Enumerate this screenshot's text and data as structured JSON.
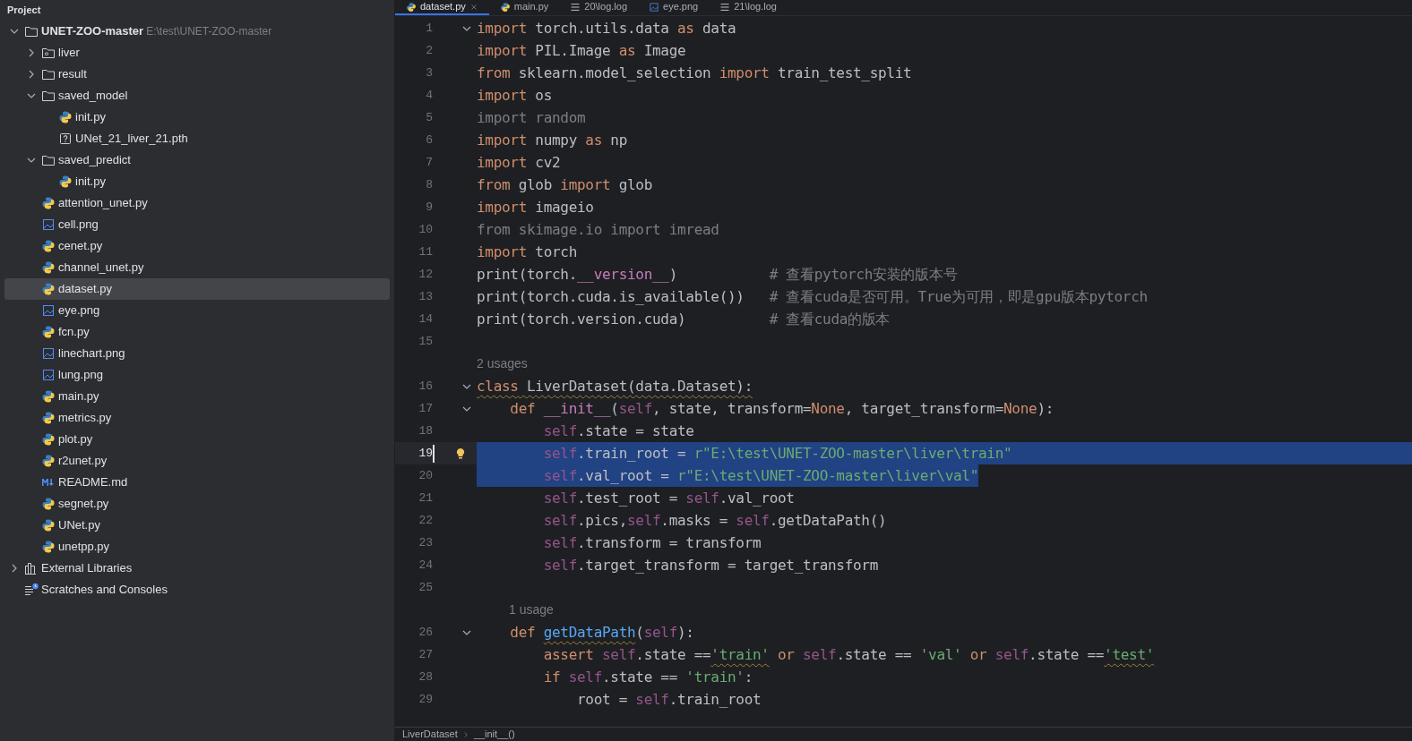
{
  "sidebar": {
    "title": "Project",
    "tree": [
      {
        "label": "UNET-ZOO-master",
        "path": "E:\\test\\UNET-ZOO-master",
        "kind": "folder",
        "expanded": true,
        "selected": false,
        "children": [
          {
            "label": "liver",
            "kind": "module-folder",
            "expanded": false,
            "selected": false
          },
          {
            "label": "result",
            "kind": "folder",
            "expanded": false,
            "selected": false
          },
          {
            "label": "saved_model",
            "kind": "folder",
            "expanded": true,
            "selected": false,
            "children": [
              {
                "label": "init.py",
                "kind": "python",
                "selected": false
              },
              {
                "label": "UNet_21_liver_21.pth",
                "kind": "unknown",
                "selected": false
              }
            ]
          },
          {
            "label": "saved_predict",
            "kind": "folder",
            "expanded": true,
            "selected": false,
            "children": [
              {
                "label": "init.py",
                "kind": "python",
                "selected": false
              }
            ]
          },
          {
            "label": "attention_unet.py",
            "kind": "python",
            "selected": false
          },
          {
            "label": "cell.png",
            "kind": "image",
            "selected": false
          },
          {
            "label": "cenet.py",
            "kind": "python",
            "selected": false
          },
          {
            "label": "channel_unet.py",
            "kind": "python",
            "selected": false
          },
          {
            "label": "dataset.py",
            "kind": "python",
            "selected": true
          },
          {
            "label": "eye.png",
            "kind": "image",
            "selected": false
          },
          {
            "label": "fcn.py",
            "kind": "python",
            "selected": false
          },
          {
            "label": "linechart.png",
            "kind": "image",
            "selected": false
          },
          {
            "label": "lung.png",
            "kind": "image",
            "selected": false
          },
          {
            "label": "main.py",
            "kind": "python",
            "selected": false
          },
          {
            "label": "metrics.py",
            "kind": "python",
            "selected": false
          },
          {
            "label": "plot.py",
            "kind": "python",
            "selected": false
          },
          {
            "label": "r2unet.py",
            "kind": "python",
            "selected": false
          },
          {
            "label": "README.md",
            "kind": "markdown",
            "selected": false
          },
          {
            "label": "segnet.py",
            "kind": "python",
            "selected": false
          },
          {
            "label": "UNet.py",
            "kind": "python",
            "selected": false
          },
          {
            "label": "unetpp.py",
            "kind": "python",
            "selected": false
          }
        ]
      },
      {
        "label": "External Libraries",
        "kind": "libraries",
        "expanded": false,
        "selected": false
      },
      {
        "label": "Scratches and Consoles",
        "kind": "scratches",
        "selected": false
      }
    ]
  },
  "tabs": [
    {
      "label": "dataset.py",
      "kind": "python",
      "selected": true,
      "closable": true
    },
    {
      "label": "main.py",
      "kind": "python",
      "selected": false,
      "closable": false
    },
    {
      "label": "20\\log.log",
      "kind": "text",
      "selected": false,
      "closable": false
    },
    {
      "label": "eye.png",
      "kind": "image",
      "selected": false,
      "closable": false
    },
    {
      "label": "21\\log.log",
      "kind": "text",
      "selected": false,
      "closable": false
    }
  ],
  "editor": {
    "lines": [
      {
        "kind": "code",
        "number": "1",
        "fold": true,
        "selected": false,
        "current": false,
        "tokens": [
          {
            "kind": "keyword",
            "text": "import"
          },
          {
            "kind": "plain",
            "text": " torch.utils.data "
          },
          {
            "kind": "keyword",
            "text": "as"
          },
          {
            "kind": "plain",
            "text": " data"
          }
        ]
      },
      {
        "kind": "code",
        "number": "2",
        "fold": false,
        "selected": false,
        "current": false,
        "tokens": [
          {
            "kind": "keyword",
            "text": "import"
          },
          {
            "kind": "plain",
            "text": " PIL.Image "
          },
          {
            "kind": "keyword",
            "text": "as"
          },
          {
            "kind": "plain",
            "text": " Image"
          }
        ]
      },
      {
        "kind": "code",
        "number": "3",
        "fold": false,
        "selected": false,
        "current": false,
        "tokens": [
          {
            "kind": "keyword",
            "text": "from"
          },
          {
            "kind": "plain",
            "text": " sklearn.model_selection "
          },
          {
            "kind": "keyword",
            "text": "import"
          },
          {
            "kind": "plain",
            "text": " train_test_split"
          }
        ]
      },
      {
        "kind": "code",
        "number": "4",
        "fold": false,
        "selected": false,
        "current": false,
        "tokens": [
          {
            "kind": "keyword",
            "text": "import"
          },
          {
            "kind": "plain",
            "text": " os"
          }
        ]
      },
      {
        "kind": "code",
        "number": "5",
        "fold": false,
        "selected": false,
        "current": false,
        "tokens": [
          {
            "kind": "unused",
            "text": "import random"
          }
        ]
      },
      {
        "kind": "code",
        "number": "6",
        "fold": false,
        "selected": false,
        "current": false,
        "tokens": [
          {
            "kind": "keyword",
            "text": "import"
          },
          {
            "kind": "plain",
            "text": " numpy "
          },
          {
            "kind": "keyword",
            "text": "as"
          },
          {
            "kind": "plain",
            "text": " np"
          }
        ]
      },
      {
        "kind": "code",
        "number": "7",
        "fold": false,
        "selected": false,
        "current": false,
        "tokens": [
          {
            "kind": "keyword",
            "text": "import"
          },
          {
            "kind": "plain",
            "text": " cv2"
          }
        ]
      },
      {
        "kind": "code",
        "number": "8",
        "fold": false,
        "selected": false,
        "current": false,
        "tokens": [
          {
            "kind": "keyword",
            "text": "from"
          },
          {
            "kind": "plain",
            "text": " glob "
          },
          {
            "kind": "keyword",
            "text": "import"
          },
          {
            "kind": "plain",
            "text": " glob"
          }
        ]
      },
      {
        "kind": "code",
        "number": "9",
        "fold": false,
        "selected": false,
        "current": false,
        "tokens": [
          {
            "kind": "keyword",
            "text": "import"
          },
          {
            "kind": "plain",
            "text": " imageio"
          }
        ]
      },
      {
        "kind": "code",
        "number": "10",
        "fold": false,
        "selected": false,
        "current": false,
        "tokens": [
          {
            "kind": "unused",
            "text": "from skimage.io import imread"
          }
        ]
      },
      {
        "kind": "code",
        "number": "11",
        "fold": false,
        "selected": false,
        "current": false,
        "tokens": [
          {
            "kind": "keyword",
            "text": "import"
          },
          {
            "kind": "plain",
            "text": " torch"
          }
        ]
      },
      {
        "kind": "code",
        "number": "12",
        "fold": false,
        "selected": false,
        "current": false,
        "tokens": [
          {
            "kind": "plain",
            "text": "print(torch."
          },
          {
            "kind": "magic",
            "text": "__version__"
          },
          {
            "kind": "plain",
            "text": ")           "
          },
          {
            "kind": "comment",
            "text": "# 查看pytorch安装的版本号"
          }
        ]
      },
      {
        "kind": "code",
        "number": "13",
        "fold": false,
        "selected": false,
        "current": false,
        "tokens": [
          {
            "kind": "plain",
            "text": "print(torch.cuda.is_available())   "
          },
          {
            "kind": "comment",
            "text": "# 查看cuda是否可用。True为可用，即是gpu版本pytorch"
          }
        ]
      },
      {
        "kind": "code",
        "number": "14",
        "fold": false,
        "selected": false,
        "current": false,
        "tokens": [
          {
            "kind": "plain",
            "text": "print(torch.version.cuda)          "
          },
          {
            "kind": "comment",
            "text": "# 查看cuda的版本"
          }
        ]
      },
      {
        "kind": "code",
        "number": "15",
        "fold": false,
        "current": false
      },
      {
        "kind": "hint",
        "text": "2 usages",
        "indented": false
      },
      {
        "kind": "code",
        "number": "16",
        "fold": true,
        "selected": false,
        "current": false,
        "tokens": [
          {
            "kind": "keyword",
            "text": "class",
            "wavy": true
          },
          {
            "kind": "plain",
            "text": " LiverDataset(data.Dataset):",
            "wavy": true
          }
        ]
      },
      {
        "kind": "code",
        "number": "17",
        "fold": true,
        "selected": false,
        "current": false,
        "tokens": [
          {
            "kind": "keyword",
            "text": "    def "
          },
          {
            "kind": "magic",
            "text": "__init__"
          },
          {
            "kind": "plain",
            "text": "("
          },
          {
            "kind": "self",
            "text": "self"
          },
          {
            "kind": "plain",
            "text": ", state, transform="
          },
          {
            "kind": "keyword",
            "text": "None"
          },
          {
            "kind": "plain",
            "text": ", target_transform="
          },
          {
            "kind": "keyword",
            "text": "None"
          },
          {
            "kind": "plain",
            "text": "):"
          }
        ]
      },
      {
        "kind": "code",
        "number": "18",
        "fold": false,
        "selected": false,
        "current": false,
        "tokens": [
          {
            "kind": "self",
            "text": "        self"
          },
          {
            "kind": "plain",
            "text": ".state = state"
          }
        ]
      },
      {
        "kind": "code",
        "number": "19",
        "fold": false,
        "selected": true,
        "current": true,
        "tokens": [
          {
            "kind": "self",
            "text": "        self"
          },
          {
            "kind": "plain",
            "text": ".train_root = "
          },
          {
            "kind": "string",
            "text": "r\"E:\\test\\UNET-ZOO-master\\liver\\train\""
          }
        ]
      },
      {
        "kind": "code",
        "number": "20",
        "fold": false,
        "selected": true,
        "current": false,
        "tokens": [
          {
            "kind": "self",
            "text": "        self"
          },
          {
            "kind": "plain",
            "text": ".val_root = "
          },
          {
            "kind": "string",
            "text": "r\"E:\\test\\UNET-ZOO-master\\liver\\val\""
          }
        ]
      },
      {
        "kind": "code",
        "number": "21",
        "fold": false,
        "selected": false,
        "current": false,
        "tokens": [
          {
            "kind": "self",
            "text": "        self"
          },
          {
            "kind": "plain",
            "text": ".test_root = "
          },
          {
            "kind": "self",
            "text": "self"
          },
          {
            "kind": "plain",
            "text": ".val_root"
          }
        ]
      },
      {
        "kind": "code",
        "number": "22",
        "fold": false,
        "selected": false,
        "current": false,
        "tokens": [
          {
            "kind": "self",
            "text": "        self"
          },
          {
            "kind": "plain",
            "text": ".pics,"
          },
          {
            "kind": "self",
            "text": "self"
          },
          {
            "kind": "plain",
            "text": ".masks = "
          },
          {
            "kind": "self",
            "text": "self"
          },
          {
            "kind": "plain",
            "text": ".getDataPath()"
          }
        ]
      },
      {
        "kind": "code",
        "number": "23",
        "fold": false,
        "selected": false,
        "current": false,
        "tokens": [
          {
            "kind": "self",
            "text": "        self"
          },
          {
            "kind": "plain",
            "text": ".transform = transform"
          }
        ]
      },
      {
        "kind": "code",
        "number": "24",
        "fold": false,
        "selected": false,
        "current": false,
        "tokens": [
          {
            "kind": "self",
            "text": "        self"
          },
          {
            "kind": "plain",
            "text": ".target_transform = target_transform"
          }
        ]
      },
      {
        "kind": "code",
        "number": "25",
        "fold": false,
        "current": false
      },
      {
        "kind": "hint",
        "text": "1 usage",
        "indented": true
      },
      {
        "kind": "code",
        "number": "26",
        "fold": true,
        "selected": false,
        "current": false,
        "tokens": [
          {
            "kind": "keyword",
            "text": "    def "
          },
          {
            "kind": "function",
            "text": "getDataPath",
            "wavy": true
          },
          {
            "kind": "plain",
            "text": "("
          },
          {
            "kind": "self",
            "text": "self"
          },
          {
            "kind": "plain",
            "text": "):"
          }
        ]
      },
      {
        "kind": "code",
        "number": "27",
        "fold": false,
        "selected": false,
        "current": false,
        "tokens": [
          {
            "kind": "keyword",
            "text": "        assert "
          },
          {
            "kind": "self",
            "text": "self"
          },
          {
            "kind": "plain",
            "text": ".state =="
          },
          {
            "kind": "string",
            "text": "'train'",
            "wavy": true
          },
          {
            "kind": "keyword",
            "text": " or "
          },
          {
            "kind": "self",
            "text": "self"
          },
          {
            "kind": "plain",
            "text": ".state == "
          },
          {
            "kind": "string",
            "text": "'val'"
          },
          {
            "kind": "keyword",
            "text": " or "
          },
          {
            "kind": "self",
            "text": "self"
          },
          {
            "kind": "plain",
            "text": ".state =="
          },
          {
            "kind": "string",
            "text": "'test'",
            "wavy": true
          }
        ]
      },
      {
        "kind": "code",
        "number": "28",
        "fold": false,
        "selected": false,
        "current": false,
        "tokens": [
          {
            "kind": "keyword",
            "text": "        if "
          },
          {
            "kind": "self",
            "text": "self"
          },
          {
            "kind": "plain",
            "text": ".state == "
          },
          {
            "kind": "string",
            "text": "'train'"
          },
          {
            "kind": "plain",
            "text": ":"
          }
        ]
      },
      {
        "kind": "code",
        "number": "29",
        "fold": false,
        "selected": false,
        "current": false,
        "tokens": [
          {
            "kind": "plain",
            "text": "            root = "
          },
          {
            "kind": "self",
            "text": "self"
          },
          {
            "kind": "plain",
            "text": ".train_root"
          }
        ]
      }
    ]
  },
  "breadcrumb": [
    "LiverDataset",
    "__init__()"
  ]
}
